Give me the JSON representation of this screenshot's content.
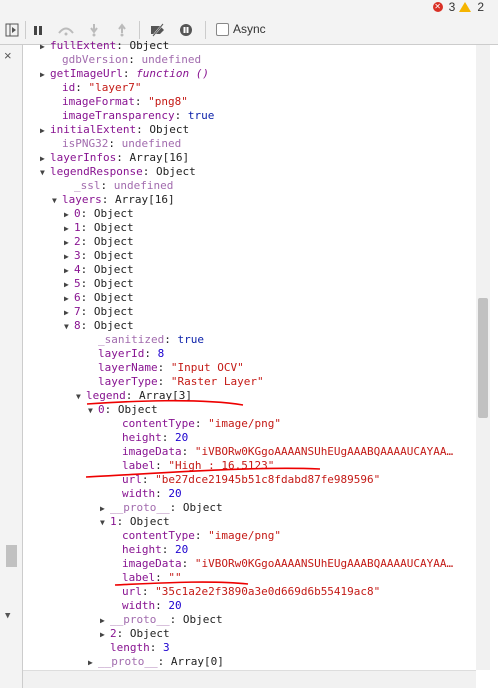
{
  "status": {
    "errors": "3",
    "warnings": "2"
  },
  "toolbar": {
    "async_label": "Async"
  },
  "sidepanel": {
    "close_label": "×"
  },
  "tree": [
    {
      "key": "fullExtent",
      "value": "Object",
      "type": "obj",
      "expand": "closed"
    },
    {
      "key": "gdbVersion",
      "value": "undefined",
      "type": "undef",
      "expand": "none"
    },
    {
      "key": "getImageUrl",
      "value": "function ()",
      "type": "fn",
      "expand": "closed"
    },
    {
      "key": "id",
      "value": "\"layer7\"",
      "type": "str",
      "expand": "none"
    },
    {
      "key": "imageFormat",
      "value": "\"png8\"",
      "type": "str",
      "expand": "none"
    },
    {
      "key": "imageTransparency",
      "value": "true",
      "type": "kw",
      "expand": "none"
    },
    {
      "key": "initialExtent",
      "value": "Object",
      "type": "obj",
      "expand": "closed"
    },
    {
      "key": "isPNG32",
      "value": "undefined",
      "type": "undef",
      "expand": "none"
    },
    {
      "key": "layerInfos",
      "value": "Array[16]",
      "type": "obj",
      "expand": "closed"
    },
    {
      "key": "legendResponse",
      "value": "Object",
      "type": "obj",
      "expand": "open"
    },
    {
      "key": "_ssl",
      "value": "undefined",
      "type": "undef",
      "expand": "none"
    },
    {
      "key": "layers",
      "value": "Array[16]",
      "type": "obj",
      "expand": "open"
    },
    {
      "key": "0",
      "value": "Object",
      "type": "obj",
      "expand": "closed"
    },
    {
      "key": "1",
      "value": "Object",
      "type": "obj",
      "expand": "closed"
    },
    {
      "key": "2",
      "value": "Object",
      "type": "obj",
      "expand": "closed"
    },
    {
      "key": "3",
      "value": "Object",
      "type": "obj",
      "expand": "closed"
    },
    {
      "key": "4",
      "value": "Object",
      "type": "obj",
      "expand": "closed"
    },
    {
      "key": "5",
      "value": "Object",
      "type": "obj",
      "expand": "closed"
    },
    {
      "key": "6",
      "value": "Object",
      "type": "obj",
      "expand": "closed"
    },
    {
      "key": "7",
      "value": "Object",
      "type": "obj",
      "expand": "closed"
    },
    {
      "key": "8",
      "value": "Object",
      "type": "obj",
      "expand": "open"
    },
    {
      "key": "_sanitized",
      "value": "true",
      "type": "kw",
      "expand": "none"
    },
    {
      "key": "layerId",
      "value": "8",
      "type": "num",
      "expand": "none"
    },
    {
      "key": "layerName",
      "value": "\"Input OCV\"",
      "type": "str",
      "expand": "none"
    },
    {
      "key": "layerType",
      "value": "\"Raster Layer\"",
      "type": "str",
      "expand": "none"
    },
    {
      "key": "legend",
      "value": "Array[3]",
      "type": "obj",
      "expand": "open"
    },
    {
      "key": "0",
      "value": "Object",
      "type": "obj",
      "expand": "open"
    },
    {
      "key": "contentType",
      "value": "\"image/png\"",
      "type": "str",
      "expand": "none"
    },
    {
      "key": "height",
      "value": "20",
      "type": "num",
      "expand": "none"
    },
    {
      "key": "imageData",
      "value": "\"iVBORw0KGgoAAAANSUhEUgAAABQAAAAUCAYAA…",
      "type": "str",
      "expand": "none"
    },
    {
      "key": "label",
      "value": "\"High : 16.5123\"",
      "type": "str",
      "expand": "none"
    },
    {
      "key": "url",
      "value": "\"be27dce21945b51c8fdabd87fe989596\"",
      "type": "str",
      "expand": "none"
    },
    {
      "key": "width",
      "value": "20",
      "type": "num",
      "expand": "none"
    },
    {
      "key": "__proto__",
      "value": "Object",
      "type": "obj",
      "expand": "closed"
    },
    {
      "key": "1",
      "value": "Object",
      "type": "obj",
      "expand": "open"
    },
    {
      "key": "contentType",
      "value": "\"image/png\"",
      "type": "str",
      "expand": "none"
    },
    {
      "key": "height",
      "value": "20",
      "type": "num",
      "expand": "none"
    },
    {
      "key": "imageData",
      "value": "\"iVBORw0KGgoAAAANSUhEUgAAABQAAAAUCAYAA…",
      "type": "str",
      "expand": "none"
    },
    {
      "key": "label",
      "value": "\"\"",
      "type": "str",
      "expand": "none"
    },
    {
      "key": "url",
      "value": "\"35c1a2e2f3890a3e0d669d6b55419ac8\"",
      "type": "str",
      "expand": "none"
    },
    {
      "key": "width",
      "value": "20",
      "type": "num",
      "expand": "none"
    },
    {
      "key": "__proto__",
      "value": "Object",
      "type": "obj",
      "expand": "closed"
    },
    {
      "key": "2",
      "value": "Object",
      "type": "obj",
      "expand": "closed"
    },
    {
      "key": "length",
      "value": "3",
      "type": "num",
      "expand": "none"
    },
    {
      "key": "__proto__",
      "value": "Array[0]",
      "type": "obj",
      "expand": "closed"
    }
  ]
}
